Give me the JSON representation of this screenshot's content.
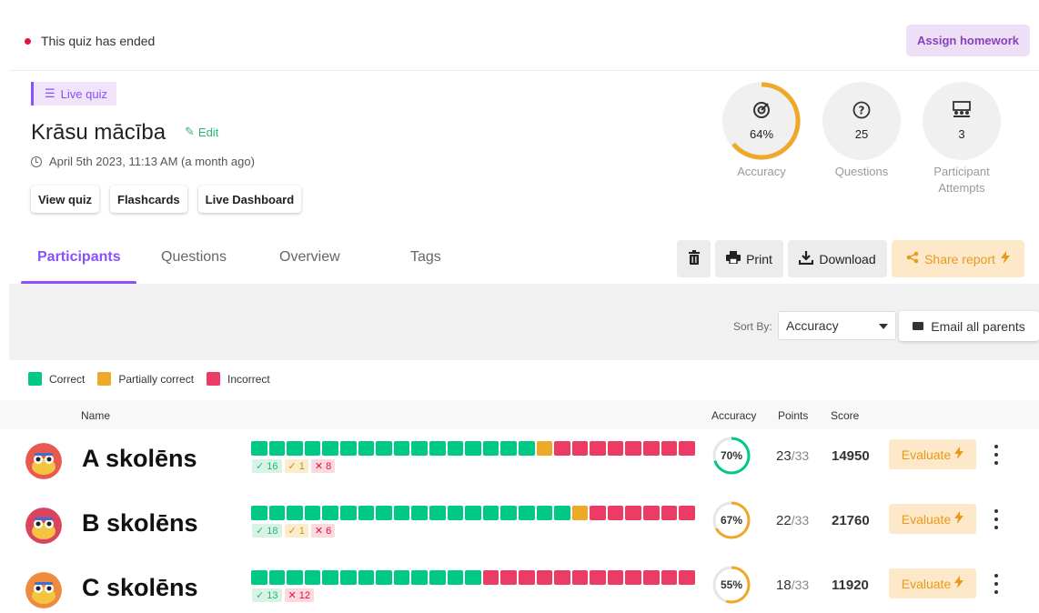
{
  "status": {
    "text": "This quiz has ended",
    "color": "#e0143c"
  },
  "assign_button": "Assign homework",
  "quiz": {
    "badge": "Live quiz",
    "title": "Krāsu mācība",
    "edit_label": "Edit",
    "date": "April 5th 2023, 11:13 AM (a month ago)",
    "buttons": [
      "View quiz",
      "Flashcards",
      "Live Dashboard"
    ]
  },
  "stats": {
    "accuracy": {
      "value": "64%",
      "label": "Accuracy",
      "fraction": 0.64,
      "icon": "target-icon"
    },
    "questions": {
      "value": "25",
      "label": "Questions",
      "icon": "question-icon"
    },
    "attempts": {
      "value": "3",
      "label_line1": "Participant",
      "label_line2": "Attempts",
      "icon": "classroom-icon"
    }
  },
  "tabs": [
    "Participants",
    "Questions",
    "Overview",
    "Tags"
  ],
  "active_tab": "Participants",
  "toolbar": {
    "print": "Print",
    "download": "Download",
    "share": "Share report"
  },
  "sort": {
    "label": "Sort By:",
    "value": "Accuracy",
    "email_button": "Email all parents"
  },
  "legend": [
    {
      "label": "Correct",
      "color": "#00c985"
    },
    {
      "label": "Partially correct",
      "color": "#efa929"
    },
    {
      "label": "Incorrect",
      "color": "#ec3b65"
    }
  ],
  "table_headers": {
    "name": "Name",
    "accuracy": "Accuracy",
    "points": "Points",
    "score": "Score"
  },
  "evaluate_label": "Evaluate",
  "participants": [
    {
      "name": "A skolēns",
      "correct": "16",
      "partial": "1",
      "incorrect": "8",
      "correct_n": 16,
      "partial_n": 1,
      "incorrect_n": 8,
      "accuracy": "70%",
      "accuracy_fraction": 0.7,
      "points": "23",
      "points_total": "/33",
      "score": "14950",
      "avatar_color": "#e85a4f"
    },
    {
      "name": "B skolēns",
      "correct": "18",
      "partial": "1",
      "incorrect": "6",
      "correct_n": 18,
      "partial_n": 1,
      "incorrect_n": 6,
      "accuracy": "67%",
      "accuracy_fraction": 0.67,
      "points": "22",
      "points_total": "/33",
      "score": "21760",
      "avatar_color": "#d9455f"
    },
    {
      "name": "C skolēns",
      "correct": "13",
      "partial": "",
      "incorrect": "12",
      "correct_n": 13,
      "partial_n": 0,
      "incorrect_n": 12,
      "accuracy": "55%",
      "accuracy_fraction": 0.55,
      "points": "18",
      "points_total": "/33",
      "score": "11920",
      "avatar_color": "#f08a3c"
    }
  ],
  "colors": {
    "accent": "#8a4fff",
    "correct": "#00c985",
    "partial": "#efa929",
    "incorrect": "#ec3b65",
    "ring": "#efa929"
  }
}
